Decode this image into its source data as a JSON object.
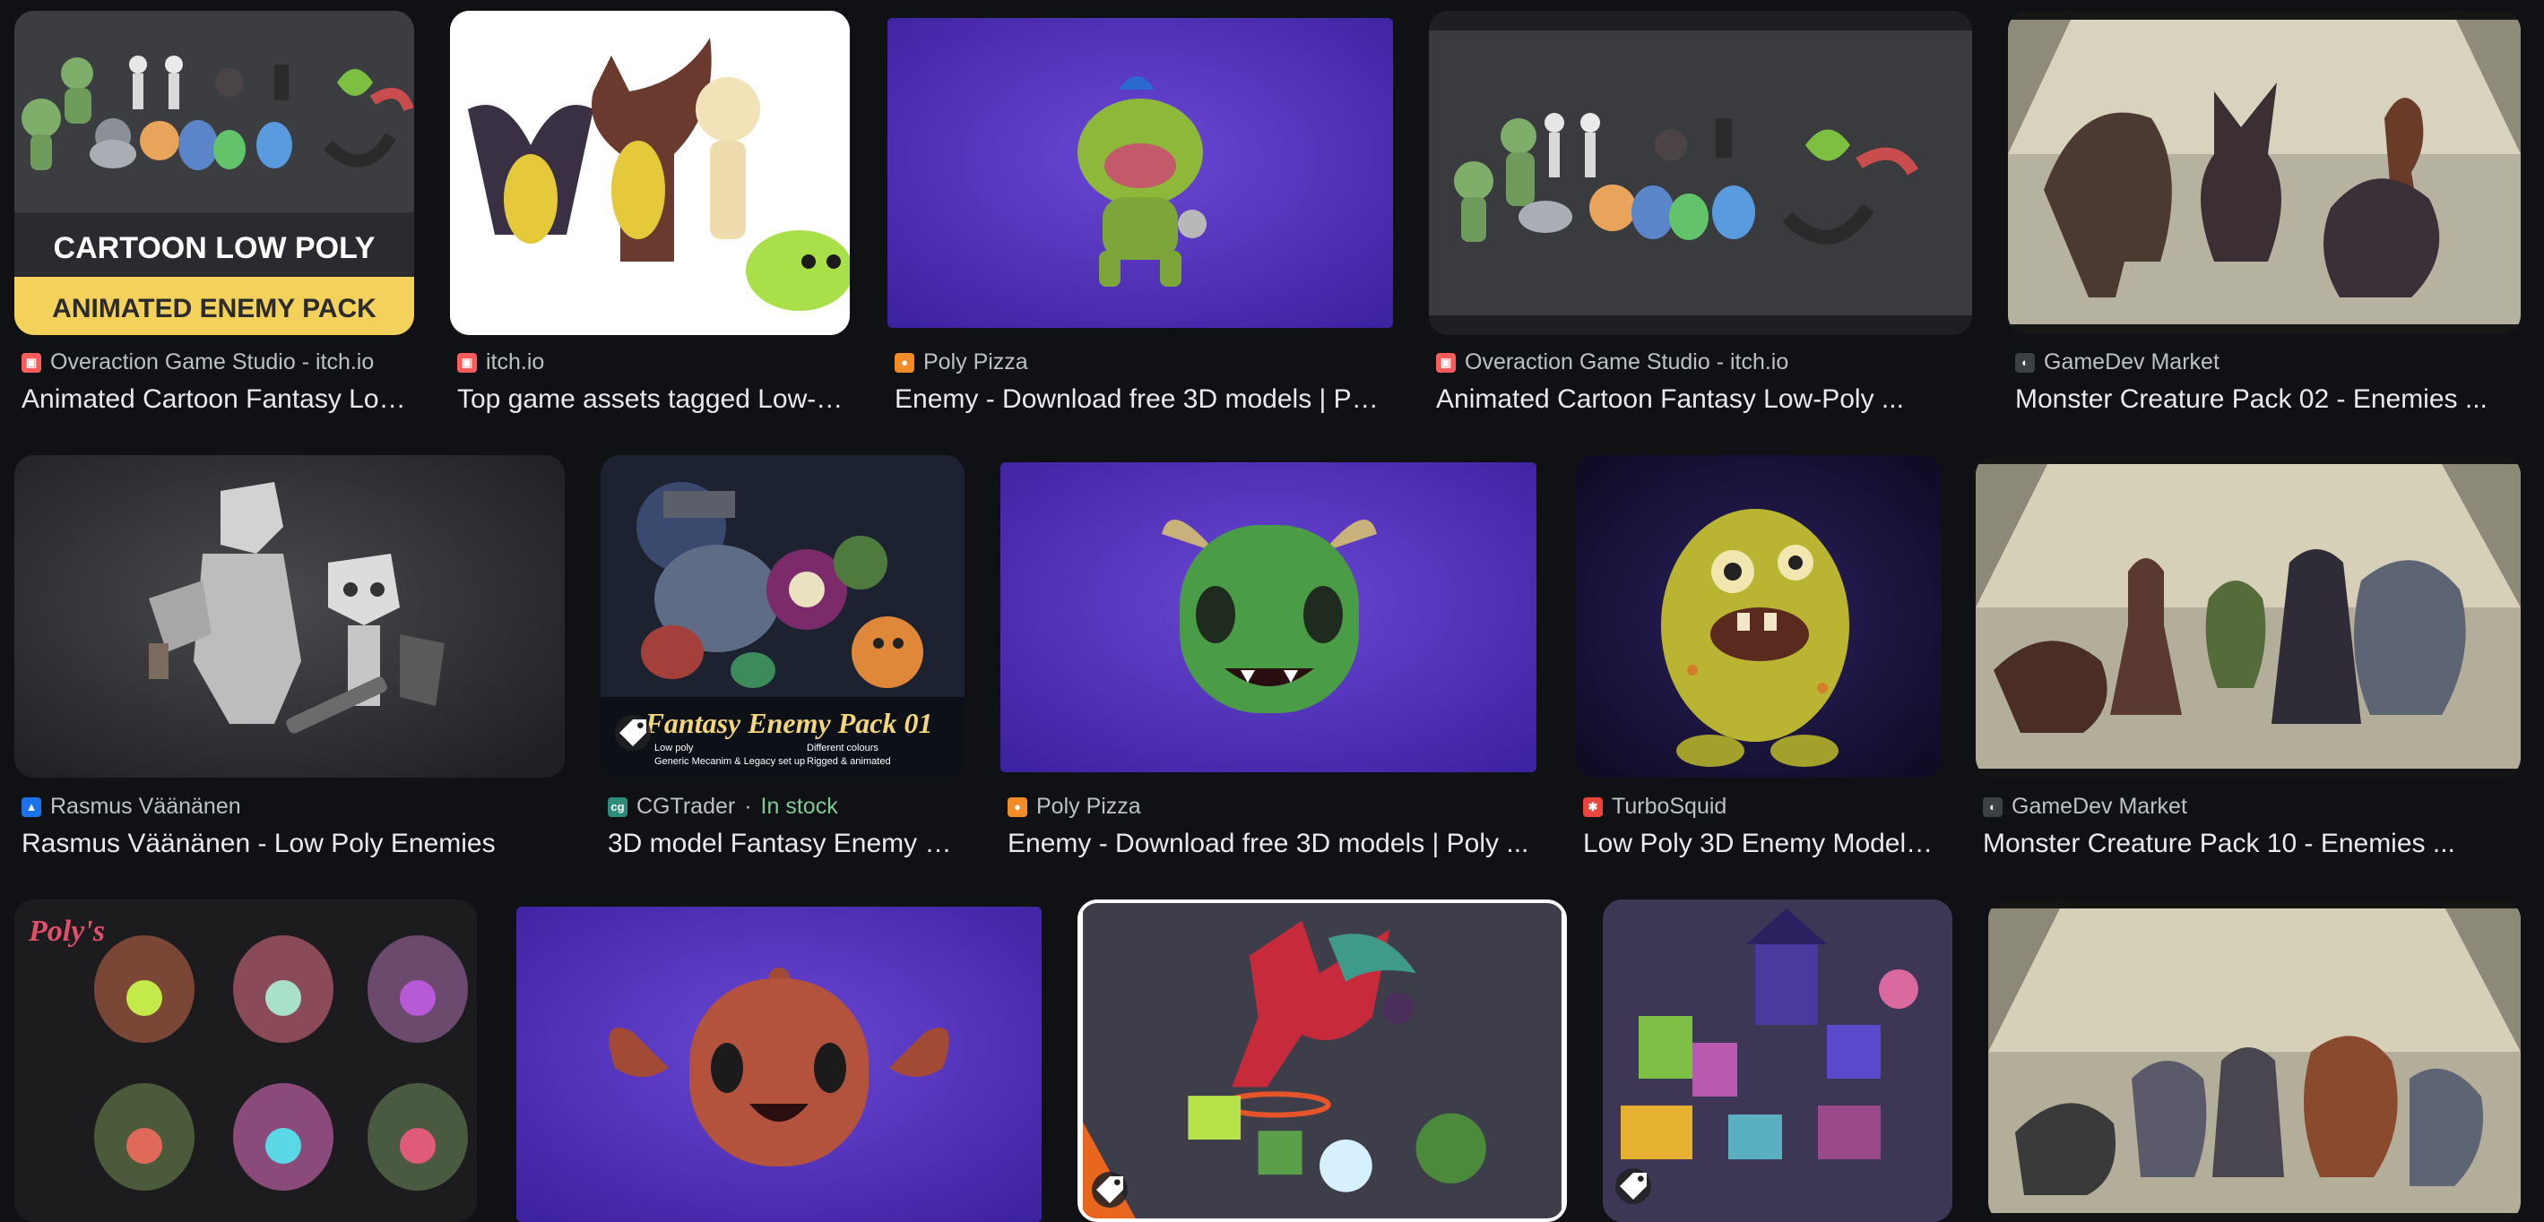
{
  "results": [
    {
      "source": "Overaction Game Studio - itch.io",
      "title": "Animated Cartoon Fantasy Low-...",
      "favicon": "itch-icon",
      "favicon_color": "#fa5c5c",
      "banner_line1": "CARTOON LOW POLY",
      "banner_line2": "ANIMATED ENEMY PACK"
    },
    {
      "source": "itch.io",
      "title": "Top game assets tagged Low-p...",
      "favicon": "itch-icon",
      "favicon_color": "#fa5c5c"
    },
    {
      "source": "Poly Pizza",
      "title": "Enemy - Download free 3D models | Poly ...",
      "favicon": "pizza-icon",
      "favicon_color": "#f28c28"
    },
    {
      "source": "Overaction Game Studio - itch.io",
      "title": "Animated Cartoon Fantasy Low-Poly ...",
      "favicon": "itch-icon",
      "favicon_color": "#fa5c5c"
    },
    {
      "source": "GameDev Market",
      "title": "Monster Creature Pack 02 - Enemies ...",
      "favicon": "gamedev-market-icon",
      "favicon_color": "#3c4043"
    },
    {
      "source": "Rasmus Väänänen",
      "title": "Rasmus Väänänen - Low Poly Enemies",
      "favicon": "mountain-icon",
      "favicon_color": "#1a73e8"
    },
    {
      "source": "CGTrader",
      "stock": "In stock",
      "title": "3D model Fantasy Enemy Pa...",
      "favicon": "cgtrader-icon",
      "favicon_color": "#2d8c7a",
      "banner_line1": "Fantasy Enemy Pack 01",
      "features": [
        "Low poly",
        "Different colours",
        "Generic Mecanim & Legacy set up",
        "Rigged & animated"
      ]
    },
    {
      "source": "Poly Pizza",
      "title": "Enemy - Download free 3D models | Poly ...",
      "favicon": "pizza-icon",
      "favicon_color": "#f28c28"
    },
    {
      "source": "TurboSquid",
      "title": "Low Poly 3D Enemy Models ...",
      "favicon": "turbosquid-icon",
      "favicon_color": "#e8453c"
    },
    {
      "source": "GameDev Market",
      "title": "Monster Creature Pack 10 - Enemies ...",
      "favicon": "gamedev-market-icon",
      "favicon_color": "#3c4043"
    },
    {
      "source": "",
      "title": "",
      "banner_line1": "Poly's"
    },
    {
      "source": "",
      "title": ""
    },
    {
      "source": "",
      "title": ""
    },
    {
      "source": "",
      "title": ""
    },
    {
      "source": "",
      "title": ""
    }
  ]
}
